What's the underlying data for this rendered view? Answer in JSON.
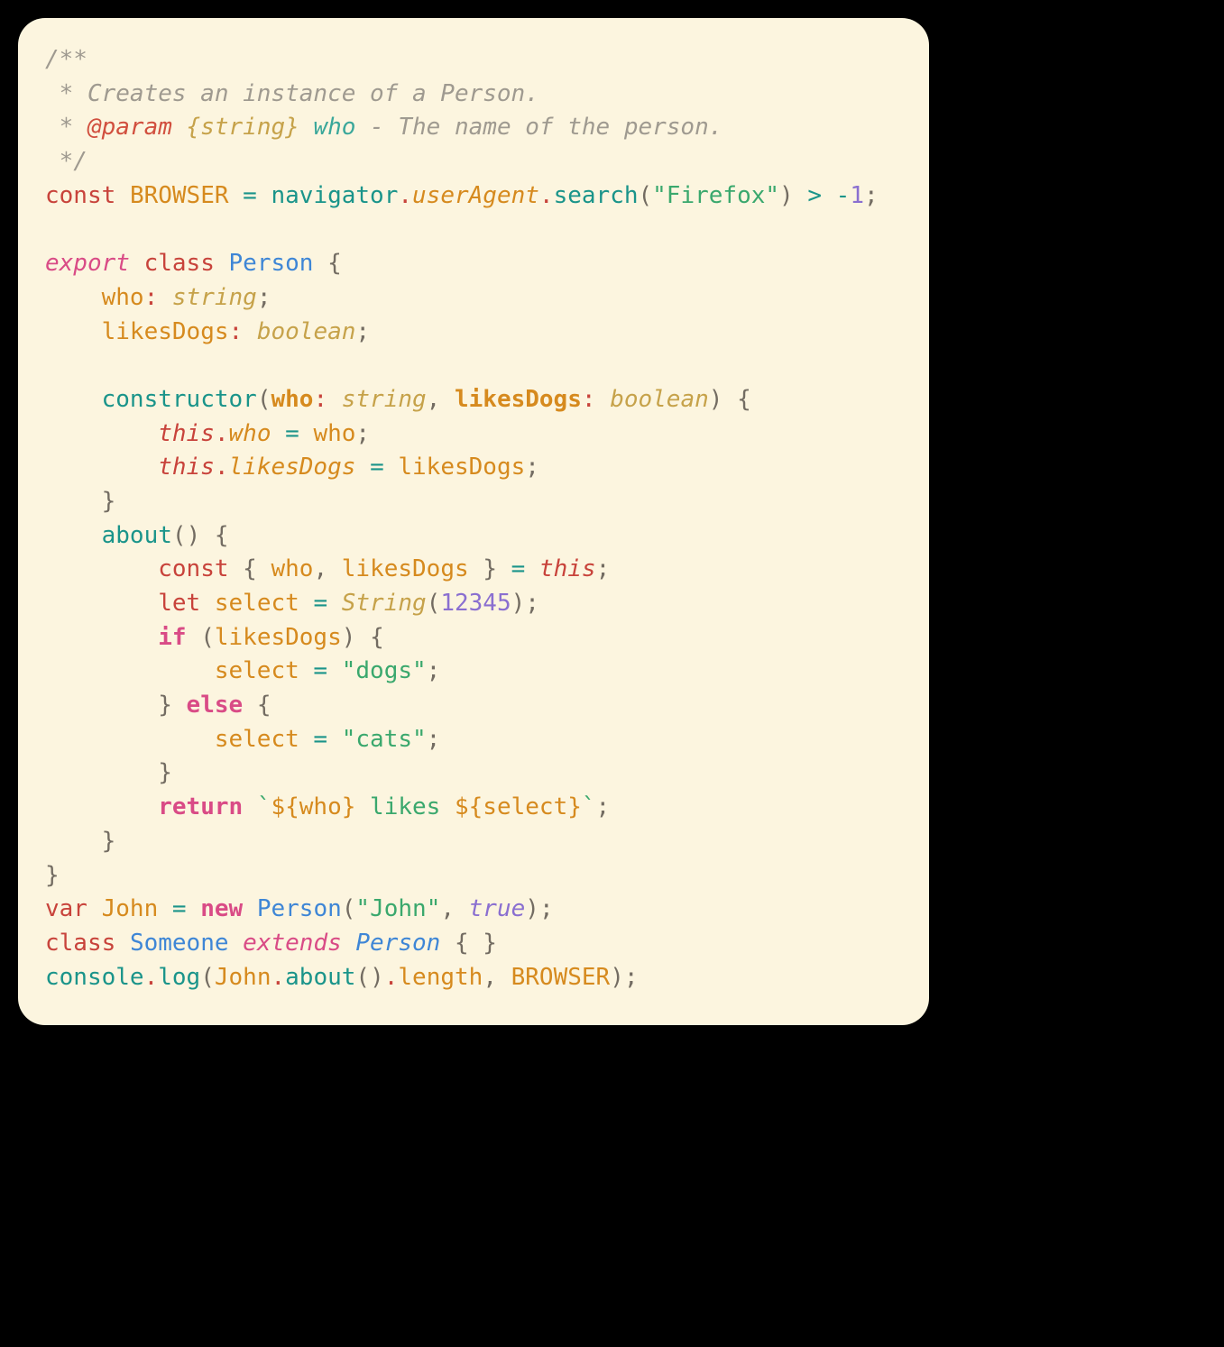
{
  "code": {
    "tokens": [
      {
        "t": "/**",
        "c": "c-comment"
      },
      {
        "t": "\n",
        "c": ""
      },
      {
        "t": " * Creates an instance of a Person.",
        "c": "c-comment"
      },
      {
        "t": "\n",
        "c": ""
      },
      {
        "t": " * ",
        "c": "c-comment"
      },
      {
        "t": "@param",
        "c": "c-tag"
      },
      {
        "t": " ",
        "c": "c-comment"
      },
      {
        "t": "{string}",
        "c": "c-tagtype"
      },
      {
        "t": " ",
        "c": "c-comment"
      },
      {
        "t": "who",
        "c": "c-tagname"
      },
      {
        "t": " - The name of the person.",
        "c": "c-comment"
      },
      {
        "t": "\n",
        "c": ""
      },
      {
        "t": " */",
        "c": "c-comment"
      },
      {
        "t": "\n",
        "c": ""
      },
      {
        "t": "const",
        "c": "c-kw-red"
      },
      {
        "t": " ",
        "c": ""
      },
      {
        "t": "BROWSER",
        "c": "c-ident"
      },
      {
        "t": " ",
        "c": ""
      },
      {
        "t": "=",
        "c": "c-op"
      },
      {
        "t": " ",
        "c": ""
      },
      {
        "t": "navigator",
        "c": "c-ident-teal"
      },
      {
        "t": ".",
        "c": "c-punc-red"
      },
      {
        "t": "userAgent",
        "c": "c-prop"
      },
      {
        "t": ".",
        "c": "c-punc-red"
      },
      {
        "t": "search",
        "c": "c-func"
      },
      {
        "t": "(",
        "c": "c-punc"
      },
      {
        "t": "\"Firefox\"",
        "c": "c-string"
      },
      {
        "t": ")",
        "c": "c-punc"
      },
      {
        "t": " ",
        "c": ""
      },
      {
        "t": ">",
        "c": "c-op"
      },
      {
        "t": " ",
        "c": ""
      },
      {
        "t": "-",
        "c": "c-op"
      },
      {
        "t": "1",
        "c": "c-num"
      },
      {
        "t": ";",
        "c": "c-punc"
      },
      {
        "t": "\n",
        "c": ""
      },
      {
        "t": "\n",
        "c": ""
      },
      {
        "t": "export",
        "c": "c-kw-pink"
      },
      {
        "t": " ",
        "c": ""
      },
      {
        "t": "class",
        "c": "c-kw-red"
      },
      {
        "t": " ",
        "c": ""
      },
      {
        "t": "Person",
        "c": "c-classname"
      },
      {
        "t": " ",
        "c": ""
      },
      {
        "t": "{",
        "c": "c-punc"
      },
      {
        "t": "\n",
        "c": ""
      },
      {
        "t": "    ",
        "c": ""
      },
      {
        "t": "who",
        "c": "c-ident"
      },
      {
        "t": ":",
        "c": "c-punc-red"
      },
      {
        "t": " ",
        "c": ""
      },
      {
        "t": "string",
        "c": "c-type"
      },
      {
        "t": ";",
        "c": "c-punc"
      },
      {
        "t": "\n",
        "c": ""
      },
      {
        "t": "    ",
        "c": ""
      },
      {
        "t": "likesDogs",
        "c": "c-ident"
      },
      {
        "t": ":",
        "c": "c-punc-red"
      },
      {
        "t": " ",
        "c": ""
      },
      {
        "t": "boolean",
        "c": "c-type"
      },
      {
        "t": ";",
        "c": "c-punc"
      },
      {
        "t": "\n",
        "c": ""
      },
      {
        "t": "\n",
        "c": ""
      },
      {
        "t": "    ",
        "c": ""
      },
      {
        "t": "constructor",
        "c": "c-func"
      },
      {
        "t": "(",
        "c": "c-punc"
      },
      {
        "t": "who",
        "c": "c-param"
      },
      {
        "t": ":",
        "c": "c-punc-red"
      },
      {
        "t": " ",
        "c": ""
      },
      {
        "t": "string",
        "c": "c-type"
      },
      {
        "t": ",",
        "c": "c-punc"
      },
      {
        "t": " ",
        "c": ""
      },
      {
        "t": "likesDogs",
        "c": "c-param"
      },
      {
        "t": ":",
        "c": "c-punc-red"
      },
      {
        "t": " ",
        "c": ""
      },
      {
        "t": "boolean",
        "c": "c-type"
      },
      {
        "t": ")",
        "c": "c-punc"
      },
      {
        "t": " ",
        "c": ""
      },
      {
        "t": "{",
        "c": "c-punc"
      },
      {
        "t": "\n",
        "c": ""
      },
      {
        "t": "        ",
        "c": ""
      },
      {
        "t": "this",
        "c": "c-this"
      },
      {
        "t": ".",
        "c": "c-punc-red"
      },
      {
        "t": "who",
        "c": "c-prop"
      },
      {
        "t": " ",
        "c": ""
      },
      {
        "t": "=",
        "c": "c-op"
      },
      {
        "t": " ",
        "c": ""
      },
      {
        "t": "who",
        "c": "c-ident"
      },
      {
        "t": ";",
        "c": "c-punc"
      },
      {
        "t": "\n",
        "c": ""
      },
      {
        "t": "        ",
        "c": ""
      },
      {
        "t": "this",
        "c": "c-this"
      },
      {
        "t": ".",
        "c": "c-punc-red"
      },
      {
        "t": "likesDogs",
        "c": "c-prop"
      },
      {
        "t": " ",
        "c": ""
      },
      {
        "t": "=",
        "c": "c-op"
      },
      {
        "t": " ",
        "c": ""
      },
      {
        "t": "likesDogs",
        "c": "c-ident"
      },
      {
        "t": ";",
        "c": "c-punc"
      },
      {
        "t": "\n",
        "c": ""
      },
      {
        "t": "    ",
        "c": ""
      },
      {
        "t": "}",
        "c": "c-punc"
      },
      {
        "t": "\n",
        "c": ""
      },
      {
        "t": "    ",
        "c": ""
      },
      {
        "t": "about",
        "c": "c-func"
      },
      {
        "t": "(",
        "c": "c-punc"
      },
      {
        "t": ")",
        "c": "c-punc"
      },
      {
        "t": " ",
        "c": ""
      },
      {
        "t": "{",
        "c": "c-punc"
      },
      {
        "t": "\n",
        "c": ""
      },
      {
        "t": "        ",
        "c": ""
      },
      {
        "t": "const",
        "c": "c-kw-red"
      },
      {
        "t": " ",
        "c": ""
      },
      {
        "t": "{",
        "c": "c-punc"
      },
      {
        "t": " ",
        "c": ""
      },
      {
        "t": "who",
        "c": "c-ident"
      },
      {
        "t": ",",
        "c": "c-punc"
      },
      {
        "t": " ",
        "c": ""
      },
      {
        "t": "likesDogs",
        "c": "c-ident"
      },
      {
        "t": " ",
        "c": ""
      },
      {
        "t": "}",
        "c": "c-punc"
      },
      {
        "t": " ",
        "c": ""
      },
      {
        "t": "=",
        "c": "c-op"
      },
      {
        "t": " ",
        "c": ""
      },
      {
        "t": "this",
        "c": "c-this"
      },
      {
        "t": ";",
        "c": "c-punc"
      },
      {
        "t": "\n",
        "c": ""
      },
      {
        "t": "        ",
        "c": ""
      },
      {
        "t": "let",
        "c": "c-kw-red"
      },
      {
        "t": " ",
        "c": ""
      },
      {
        "t": "select",
        "c": "c-ident"
      },
      {
        "t": " ",
        "c": ""
      },
      {
        "t": "=",
        "c": "c-op"
      },
      {
        "t": " ",
        "c": ""
      },
      {
        "t": "String",
        "c": "c-type"
      },
      {
        "t": "(",
        "c": "c-punc"
      },
      {
        "t": "12345",
        "c": "c-num"
      },
      {
        "t": ")",
        "c": "c-punc"
      },
      {
        "t": ";",
        "c": "c-punc"
      },
      {
        "t": "\n",
        "c": ""
      },
      {
        "t": "        ",
        "c": ""
      },
      {
        "t": "if",
        "c": "c-kw-pinkb"
      },
      {
        "t": " ",
        "c": ""
      },
      {
        "t": "(",
        "c": "c-punc"
      },
      {
        "t": "likesDogs",
        "c": "c-ident"
      },
      {
        "t": ")",
        "c": "c-punc"
      },
      {
        "t": " ",
        "c": ""
      },
      {
        "t": "{",
        "c": "c-punc"
      },
      {
        "t": "\n",
        "c": ""
      },
      {
        "t": "            ",
        "c": ""
      },
      {
        "t": "select",
        "c": "c-ident"
      },
      {
        "t": " ",
        "c": ""
      },
      {
        "t": "=",
        "c": "c-op"
      },
      {
        "t": " ",
        "c": ""
      },
      {
        "t": "\"dogs\"",
        "c": "c-string"
      },
      {
        "t": ";",
        "c": "c-punc"
      },
      {
        "t": "\n",
        "c": ""
      },
      {
        "t": "        ",
        "c": ""
      },
      {
        "t": "}",
        "c": "c-punc"
      },
      {
        "t": " ",
        "c": ""
      },
      {
        "t": "else",
        "c": "c-kw-pinkb"
      },
      {
        "t": " ",
        "c": ""
      },
      {
        "t": "{",
        "c": "c-punc"
      },
      {
        "t": "\n",
        "c": ""
      },
      {
        "t": "            ",
        "c": ""
      },
      {
        "t": "select",
        "c": "c-ident"
      },
      {
        "t": " ",
        "c": ""
      },
      {
        "t": "=",
        "c": "c-op"
      },
      {
        "t": " ",
        "c": ""
      },
      {
        "t": "\"cats\"",
        "c": "c-string"
      },
      {
        "t": ";",
        "c": "c-punc"
      },
      {
        "t": "\n",
        "c": ""
      },
      {
        "t": "        ",
        "c": ""
      },
      {
        "t": "}",
        "c": "c-punc"
      },
      {
        "t": "\n",
        "c": ""
      },
      {
        "t": "        ",
        "c": ""
      },
      {
        "t": "return",
        "c": "c-kw-pinkb"
      },
      {
        "t": " ",
        "c": ""
      },
      {
        "t": "`",
        "c": "c-punc-grn"
      },
      {
        "t": "${",
        "c": "c-tmpl"
      },
      {
        "t": "who",
        "c": "c-interp"
      },
      {
        "t": "}",
        "c": "c-tmpl"
      },
      {
        "t": " likes ",
        "c": "c-string"
      },
      {
        "t": "${",
        "c": "c-tmpl"
      },
      {
        "t": "select",
        "c": "c-interp"
      },
      {
        "t": "}",
        "c": "c-tmpl"
      },
      {
        "t": "`",
        "c": "c-punc-grn"
      },
      {
        "t": ";",
        "c": "c-punc"
      },
      {
        "t": "\n",
        "c": ""
      },
      {
        "t": "    ",
        "c": ""
      },
      {
        "t": "}",
        "c": "c-punc"
      },
      {
        "t": "\n",
        "c": ""
      },
      {
        "t": "}",
        "c": "c-punc"
      },
      {
        "t": "\n",
        "c": ""
      },
      {
        "t": "var",
        "c": "c-kw-red"
      },
      {
        "t": " ",
        "c": ""
      },
      {
        "t": "John",
        "c": "c-ident"
      },
      {
        "t": " ",
        "c": ""
      },
      {
        "t": "=",
        "c": "c-op"
      },
      {
        "t": " ",
        "c": ""
      },
      {
        "t": "new",
        "c": "c-kw-pinkb"
      },
      {
        "t": " ",
        "c": ""
      },
      {
        "t": "Person",
        "c": "c-classname"
      },
      {
        "t": "(",
        "c": "c-punc"
      },
      {
        "t": "\"John\"",
        "c": "c-string"
      },
      {
        "t": ",",
        "c": "c-punc"
      },
      {
        "t": " ",
        "c": ""
      },
      {
        "t": "true",
        "c": "c-bool"
      },
      {
        "t": ")",
        "c": "c-punc"
      },
      {
        "t": ";",
        "c": "c-punc"
      },
      {
        "t": "\n",
        "c": ""
      },
      {
        "t": "class",
        "c": "c-kw-red"
      },
      {
        "t": " ",
        "c": ""
      },
      {
        "t": "Someone",
        "c": "c-classname"
      },
      {
        "t": " ",
        "c": ""
      },
      {
        "t": "extends",
        "c": "c-kw-pink"
      },
      {
        "t": " ",
        "c": ""
      },
      {
        "t": "Person",
        "c": "c-classname-i"
      },
      {
        "t": " ",
        "c": ""
      },
      {
        "t": "{",
        "c": "c-punc"
      },
      {
        "t": " ",
        "c": ""
      },
      {
        "t": "}",
        "c": "c-punc"
      },
      {
        "t": "\n",
        "c": ""
      },
      {
        "t": "console",
        "c": "c-ident-teal"
      },
      {
        "t": ".",
        "c": "c-punc-red"
      },
      {
        "t": "log",
        "c": "c-func"
      },
      {
        "t": "(",
        "c": "c-punc"
      },
      {
        "t": "John",
        "c": "c-ident"
      },
      {
        "t": ".",
        "c": "c-punc-red"
      },
      {
        "t": "about",
        "c": "c-func"
      },
      {
        "t": "(",
        "c": "c-punc"
      },
      {
        "t": ")",
        "c": "c-punc"
      },
      {
        "t": ".",
        "c": "c-punc-red"
      },
      {
        "t": "length",
        "c": "c-ident"
      },
      {
        "t": ",",
        "c": "c-punc"
      },
      {
        "t": " ",
        "c": ""
      },
      {
        "t": "BROWSER",
        "c": "c-ident"
      },
      {
        "t": ")",
        "c": "c-punc"
      },
      {
        "t": ";",
        "c": "c-punc"
      }
    ]
  }
}
